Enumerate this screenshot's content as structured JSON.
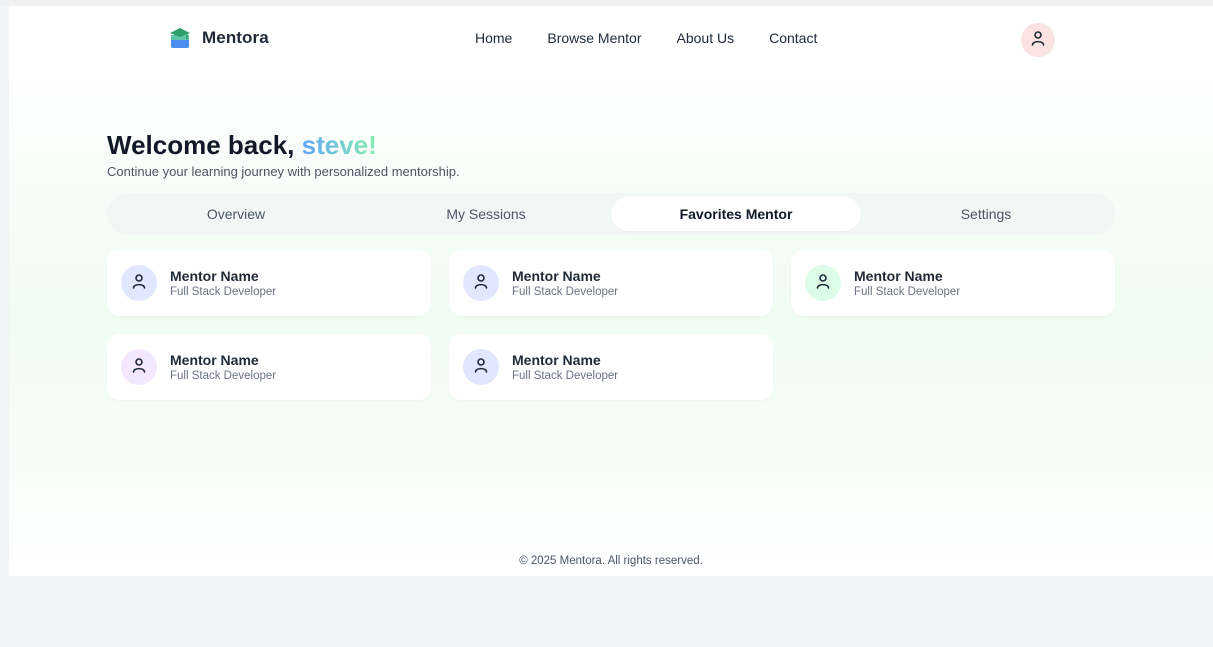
{
  "brand": {
    "name": "Mentora",
    "logo_icon": "mortarboard-book-icon"
  },
  "nav": {
    "links": [
      {
        "label": "Home"
      },
      {
        "label": "Browse Mentor"
      },
      {
        "label": "About Us"
      },
      {
        "label": "Contact"
      }
    ],
    "profile_icon": "user-icon"
  },
  "welcome": {
    "greeting": "Welcome back, ",
    "user_name": "steve!",
    "subtitle": "Continue your learning journey with personalized mentorship."
  },
  "tabs": [
    {
      "label": "Overview",
      "active": false
    },
    {
      "label": "My Sessions",
      "active": false
    },
    {
      "label": "Favorites Mentor",
      "active": true
    },
    {
      "label": "Settings",
      "active": false
    }
  ],
  "mentors": [
    {
      "name": "Mentor Name",
      "role": "Full Stack Developer",
      "avatar_color": "#e0e7ff"
    },
    {
      "name": "Mentor Name",
      "role": "Full Stack Developer",
      "avatar_color": "#e0e7ff"
    },
    {
      "name": "Mentor Name",
      "role": "Full Stack Developer",
      "avatar_color": "#dcfce7"
    },
    {
      "name": "Mentor Name",
      "role": "Full Stack Developer",
      "avatar_color": "#f3e8ff"
    },
    {
      "name": "Mentor Name",
      "role": "Full Stack Developer",
      "avatar_color": "#e0e7ff"
    }
  ],
  "footer": {
    "text": "© 2025 Mentora. All rights reserved."
  },
  "colors": {
    "accent_from": "#60a5fa",
    "accent_to": "#86efac",
    "profile_bg": "#fde2e2"
  }
}
